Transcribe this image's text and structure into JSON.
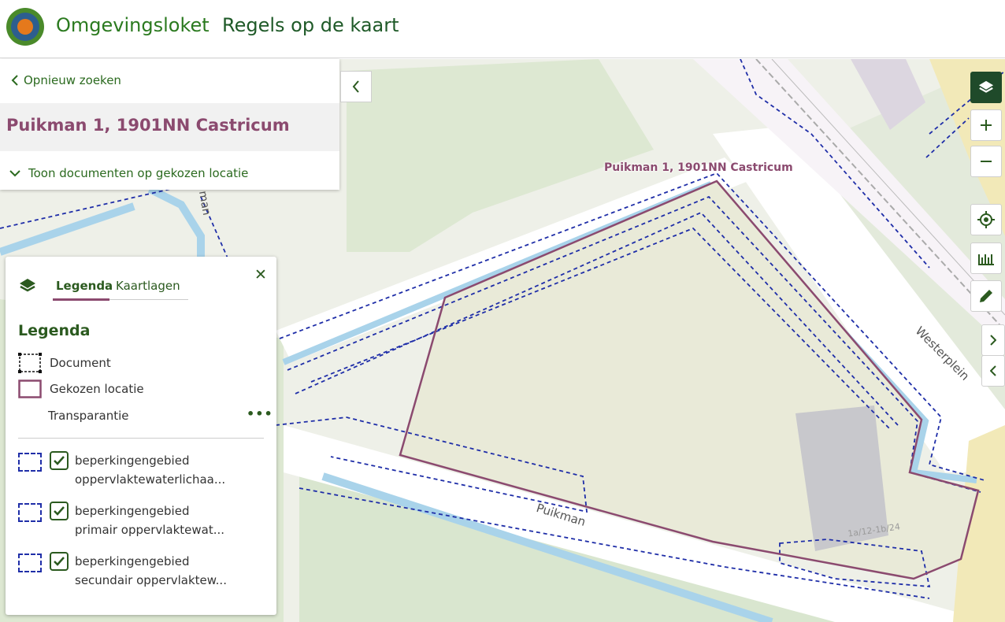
{
  "header": {
    "app_title": "Omgevingsloket",
    "page_title": "Regels op de kaart"
  },
  "search_panel": {
    "back_label": "Opnieuw zoeken",
    "address": "Puikman 1, 1901NN Castricum",
    "toggle_docs_label": "Toon documenten op gekozen locatie"
  },
  "legend": {
    "tabs": [
      {
        "label": "Legenda",
        "active": true
      },
      {
        "label": "Kaartlagen",
        "active": false
      }
    ],
    "heading": "Legenda",
    "rows": {
      "document": "Document",
      "location": "Gekozen locatie",
      "transparency": "Transparantie"
    },
    "layers": [
      {
        "label": "beperkingengebied oppervlaktewaterlichaa...",
        "checked": true
      },
      {
        "label": "beperkingengebied primair oppervlaktewat...",
        "checked": true
      },
      {
        "label": "beperkingengebied secundair oppervlaktew...",
        "checked": true
      }
    ]
  },
  "map": {
    "address_label": "Puikman 1, 1901NN Castricum",
    "street_labels": {
      "puikman": "Puikman",
      "westerplein": "Westerplein",
      "puikman_partial": "man"
    },
    "parcel_label": "1a/12-1b/24"
  },
  "colors": {
    "brand_green": "#2b7a1f",
    "location_outline": "#8b4a6f",
    "restriction_dash": "#1f2ea8",
    "water": "#a9d3ea"
  }
}
